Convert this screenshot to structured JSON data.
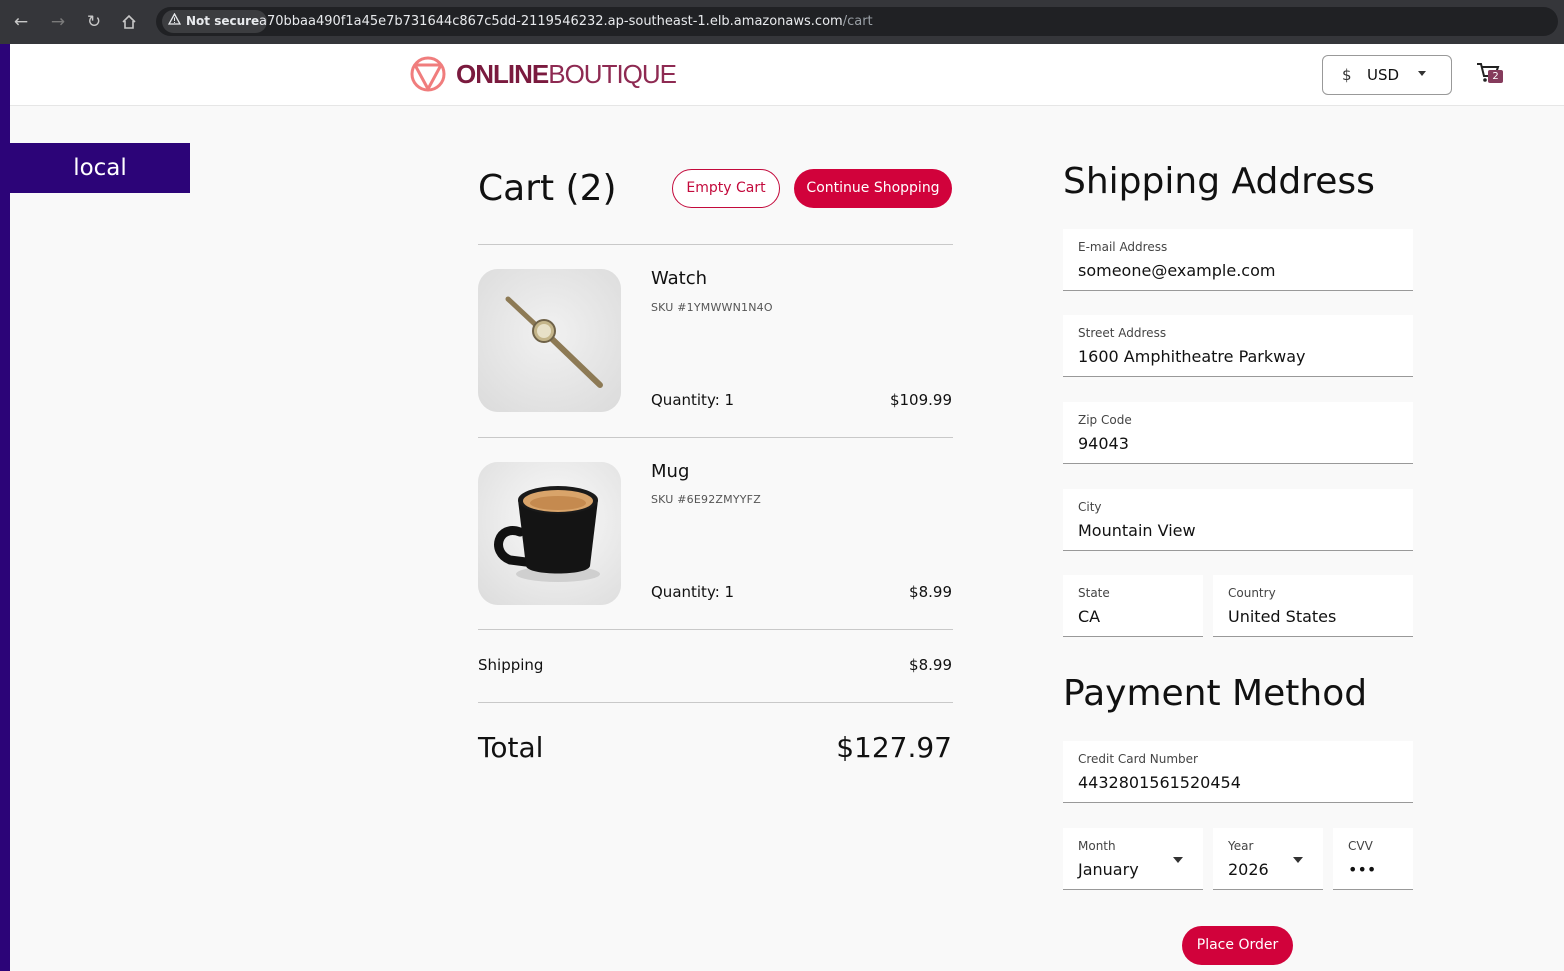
{
  "browser": {
    "security_label": "Not secure",
    "url_host": "a70bbaa490f1a45e7b731644c867c5dd-2119546232.ap-southeast-1.elb.amazonaws.com",
    "url_path": "/cart"
  },
  "env": {
    "label": "local"
  },
  "header": {
    "logo_bold": "ONLINE",
    "logo_light": "BOUTIQUE",
    "currency_symbol": "$",
    "currency_code": "USD",
    "cart_count": "2"
  },
  "cart": {
    "title": "Cart (2)",
    "empty_label": "Empty Cart",
    "continue_label": "Continue Shopping",
    "items": [
      {
        "name": "Watch",
        "sku": "SKU #1YMWWN1N4O",
        "quantity": "Quantity: 1",
        "price": "$109.99"
      },
      {
        "name": "Mug",
        "sku": "SKU #6E92ZMYYFZ",
        "quantity": "Quantity: 1",
        "price": "$8.99"
      }
    ],
    "shipping_label": "Shipping",
    "shipping_value": "$8.99",
    "total_label": "Total",
    "total_value": "$127.97"
  },
  "shipping": {
    "title": "Shipping Address",
    "email_label": "E-mail Address",
    "email_value": "someone@example.com",
    "street_label": "Street Address",
    "street_value": "1600 Amphitheatre Parkway",
    "zip_label": "Zip Code",
    "zip_value": "94043",
    "city_label": "City",
    "city_value": "Mountain View",
    "state_label": "State",
    "state_value": "CA",
    "country_label": "Country",
    "country_value": "United States"
  },
  "payment": {
    "title": "Payment Method",
    "cc_label": "Credit Card Number",
    "cc_value": "4432801561520454",
    "month_label": "Month",
    "month_value": "January",
    "year_label": "Year",
    "year_value": "2026",
    "cvv_label": "CVV",
    "cvv_value": "•••",
    "place_order_label": "Place Order"
  },
  "colors": {
    "accent": "#d1023b",
    "env_strip": "#2c0478",
    "browser_bar": "#35363a"
  }
}
